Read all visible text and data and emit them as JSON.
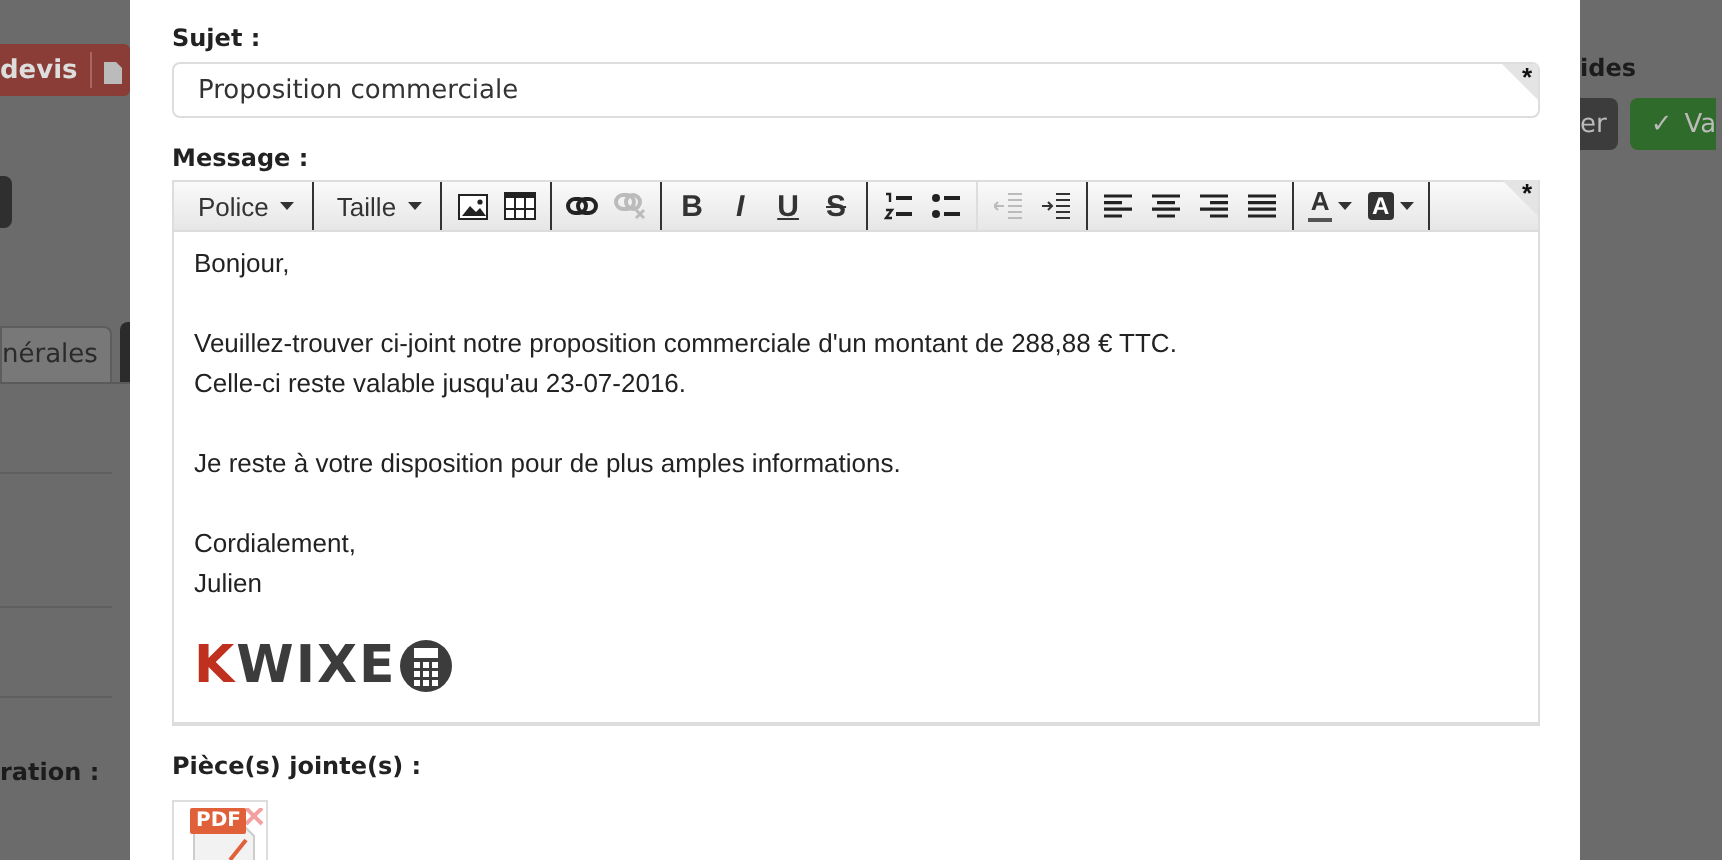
{
  "background_left": {
    "devis_button": "devis",
    "tab": "nérales",
    "field_label": "ration :"
  },
  "background_right": {
    "section_label": "ides",
    "dark_button": "er",
    "validate_button": {
      "icon": "✓",
      "label": "Va"
    }
  },
  "dialog": {
    "subject": {
      "label": "Sujet :",
      "value": "Proposition commerciale",
      "required_mark": "*"
    },
    "message": {
      "label": "Message :",
      "required_mark": "*",
      "toolbar": [
        {
          "kind": "dropdown",
          "label": "Police",
          "disabled": false
        },
        {
          "kind": "dropdown",
          "label": "Taille",
          "disabled": false
        },
        {
          "kind": "icon",
          "disabled": false
        },
        {
          "kind": "icon",
          "disabled": false
        },
        {
          "kind": "icon",
          "disabled": false
        },
        {
          "kind": "icon",
          "disabled": true
        },
        {
          "kind": "glyph",
          "label": "B",
          "disabled": false
        },
        {
          "kind": "glyph",
          "label": "I",
          "disabled": false
        },
        {
          "kind": "glyph",
          "label": "U",
          "disabled": false
        },
        {
          "kind": "glyph",
          "label": "S",
          "disabled": false
        },
        {
          "kind": "icon",
          "disabled": false
        },
        {
          "kind": "icon",
          "disabled": false
        },
        {
          "kind": "icon",
          "disabled": true
        },
        {
          "kind": "icon",
          "disabled": false
        },
        {
          "kind": "icon",
          "disabled": false
        },
        {
          "kind": "icon",
          "disabled": false
        },
        {
          "kind": "icon",
          "disabled": false
        },
        {
          "kind": "icon",
          "disabled": false
        },
        {
          "kind": "text-color",
          "label": "A",
          "disabled": false
        },
        {
          "kind": "background-color",
          "label": "A",
          "disabled": false
        }
      ],
      "paragraphs": [
        [
          "Bonjour,"
        ],
        [
          "Veuillez-trouver ci-joint notre proposition commerciale d'un montant de 288,88 € TTC.",
          "Celle-ci reste valable jusqu'au 23-07-2016."
        ],
        [
          "Je reste à votre disposition pour de plus amples informations."
        ],
        [
          "Cordialement,",
          "Julien"
        ]
      ],
      "logo": {
        "accent": "K",
        "rest": "WIXE"
      }
    },
    "attachments": {
      "label": "Pièce(s) jointe(s) :",
      "files": [
        {
          "type": "PDF"
        }
      ]
    }
  }
}
